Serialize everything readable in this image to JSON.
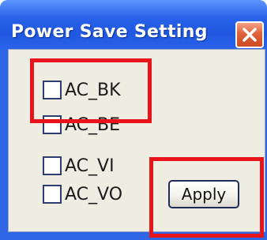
{
  "window": {
    "title": "Power Save Setting",
    "colors": {
      "titlebar": "#2a63ea",
      "client": "#efece2",
      "close": "#e0623b",
      "highlight": "#e8141c"
    }
  },
  "options": [
    {
      "label": "AC_BK",
      "checked": false
    },
    {
      "label": "AC_BE",
      "checked": false
    },
    {
      "label": "AC_VI",
      "checked": false
    },
    {
      "label": "AC_VO",
      "checked": false
    }
  ],
  "buttons": {
    "apply_label": "Apply",
    "close_icon": "close-icon"
  }
}
